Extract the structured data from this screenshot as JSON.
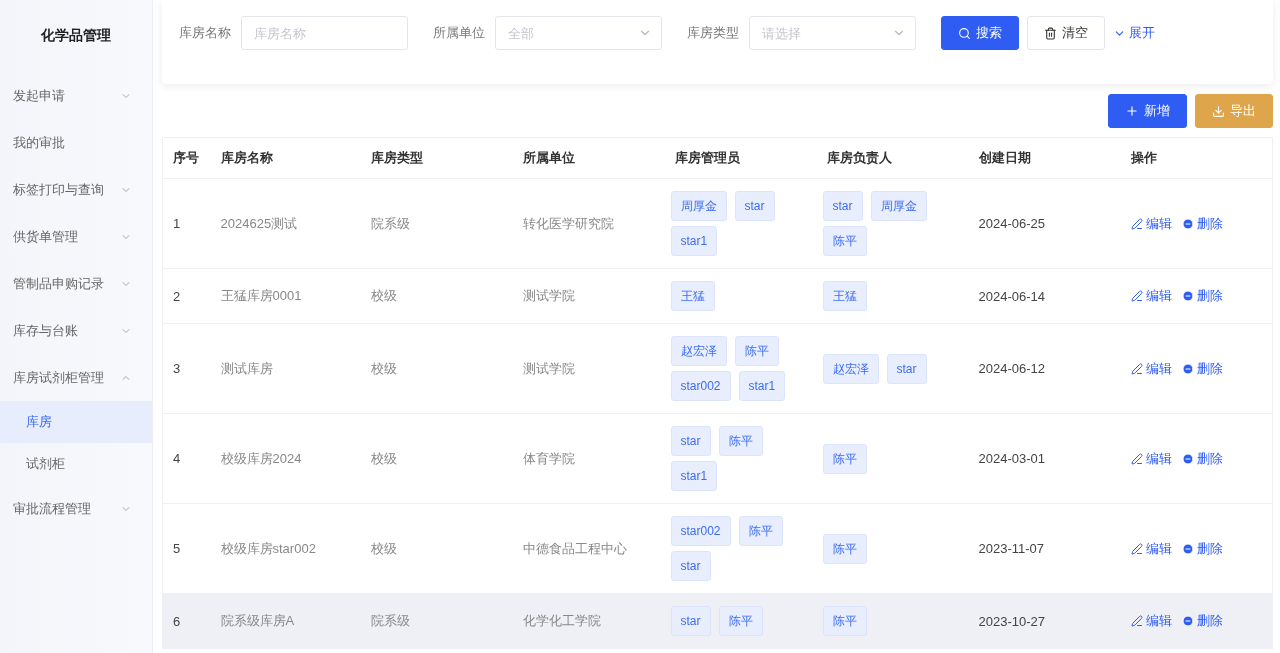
{
  "sidebar": {
    "title": "化学品管理",
    "items": [
      {
        "label": "发起申请",
        "kind": "group",
        "expanded": false
      },
      {
        "label": "我的审批",
        "kind": "link"
      },
      {
        "label": "标签打印与查询",
        "kind": "group",
        "expanded": false
      },
      {
        "label": "供货单管理",
        "kind": "group",
        "expanded": false
      },
      {
        "label": "管制品申购记录",
        "kind": "group",
        "expanded": false
      },
      {
        "label": "库存与台账",
        "kind": "group",
        "expanded": false
      },
      {
        "label": "库房试剂柜管理",
        "kind": "group",
        "expanded": true,
        "children": [
          {
            "label": "库房",
            "selected": true
          },
          {
            "label": "试剂柜",
            "selected": false
          }
        ]
      },
      {
        "label": "审批流程管理",
        "kind": "group",
        "expanded": false
      }
    ]
  },
  "filters": [
    {
      "label": "库房名称",
      "kind": "input",
      "placeholder": "库房名称"
    },
    {
      "label": "所属单位",
      "kind": "select",
      "placeholder": "全部"
    },
    {
      "label": "库房类型",
      "kind": "select",
      "placeholder": "请选择"
    }
  ],
  "search_button": "搜索",
  "clear_button": "清空",
  "expand_link": "展开",
  "add_button": "新增",
  "export_button": "导出",
  "table": {
    "columns": [
      "序号",
      "库房名称",
      "库房类型",
      "所属单位",
      "库房管理员",
      "库房负责人",
      "创建日期",
      "操作"
    ],
    "rows": [
      {
        "index": "1",
        "name": "2024625测试",
        "type": "院系级",
        "unit": "转化医学研究院",
        "admins": [
          "周厚金",
          "star",
          "star1"
        ],
        "owners": [
          "star",
          "周厚金",
          "陈平"
        ],
        "date": "2024-06-25",
        "edit": "编辑",
        "delete": "删除",
        "hovered": false
      },
      {
        "index": "2",
        "name": "王猛库房0001",
        "type": "校级",
        "unit": "测试学院",
        "admins": [
          "王猛"
        ],
        "owners": [
          "王猛"
        ],
        "date": "2024-06-14",
        "edit": "编辑",
        "delete": "删除",
        "hovered": false
      },
      {
        "index": "3",
        "name": "测试库房",
        "type": "校级",
        "unit": "测试学院",
        "admins": [
          "赵宏泽",
          "陈平",
          "star002",
          "star1"
        ],
        "owners": [
          "赵宏泽",
          "star"
        ],
        "date": "2024-06-12",
        "edit": "编辑",
        "delete": "删除",
        "hovered": false
      },
      {
        "index": "4",
        "name": "校级库房2024",
        "type": "校级",
        "unit": "体育学院",
        "admins": [
          "star",
          "陈平",
          "star1"
        ],
        "owners": [
          "陈平"
        ],
        "date": "2024-03-01",
        "edit": "编辑",
        "delete": "删除",
        "hovered": false
      },
      {
        "index": "5",
        "name": "校级库房star002",
        "type": "校级",
        "unit": "中德食品工程中心",
        "admins": [
          "star002",
          "陈平",
          "star"
        ],
        "owners": [
          "陈平"
        ],
        "date": "2023-11-07",
        "edit": "编辑",
        "delete": "删除",
        "hovered": false
      },
      {
        "index": "6",
        "name": "院系级库房A",
        "type": "院系级",
        "unit": "化学化工学院",
        "admins": [
          "star",
          "陈平"
        ],
        "owners": [
          "陈平"
        ],
        "date": "2023-10-27",
        "edit": "编辑",
        "delete": "删除",
        "hovered": true
      }
    ]
  }
}
